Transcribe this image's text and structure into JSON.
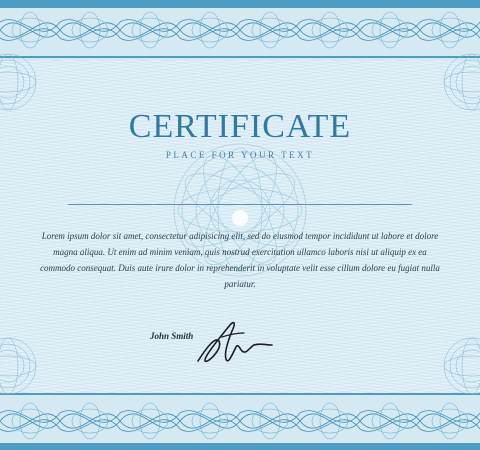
{
  "certificate": {
    "title": "CERTIFICATE",
    "subtitle": "PLACE FOR YOUR TEXT",
    "body_text": "Lorem ipsum dolor sit amet, consectetur adipisicing elit, sed do eiusmod tempor incididunt ut labore et dolore magna aliqua. Ut enim ad minim veniam, quis nostrud exercitation ullamco laboris nisi ut aliquip ex ea commodo consequat. Duis aute irure dolor in reprehenderit in voluptate velit esse cillum dolore eu fugiat nulla pariatur.",
    "signer_name": "John Smith"
  },
  "colors": {
    "accent": "#2f7aa2",
    "background": "#e3f1f8",
    "guilloche": "#3f8fb8"
  },
  "icons": {
    "signature": "handwritten-signature",
    "border": "guilloche-border",
    "watermark": "guilloche-rosette"
  }
}
